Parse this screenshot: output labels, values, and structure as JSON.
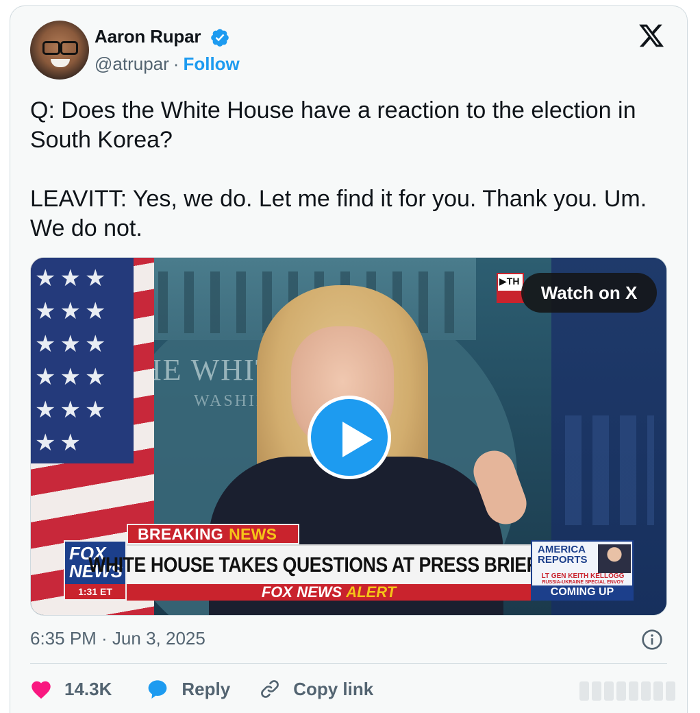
{
  "author": {
    "name": "Aaron Rupar",
    "handle": "@atrupar",
    "separator": "·",
    "follow_label": "Follow"
  },
  "tweet": {
    "paragraphs": [
      "Q: Does the White House have a reaction to the election in South Korea?",
      "LEAVITT: Yes, we do. Let me find it for you. Thank you. Um. We do not."
    ]
  },
  "media": {
    "watch_label": "Watch on X",
    "background_text": {
      "seal_main": "THE WHITE",
      "seal_sub": "WASHIN"
    },
    "chyron": {
      "breaking_label": "BREAKING",
      "breaking_highlight": "NEWS",
      "headline": "WHITE HOUSE TAKES QUESTIONS AT PRESS BRIEFING",
      "alert_label": "FOX NEWS",
      "alert_highlight": "ALERT",
      "logo_line1": "FOX",
      "logo_line2": "NEWS",
      "time": "1:31 ET",
      "promo_title": "AMERICA REPORTS",
      "promo_name": "LT GEN KEITH KELLOGG",
      "promo_role": "RUSSIA-UKRAINE SPECIAL ENVOY",
      "promo_footer": "COMING UP"
    }
  },
  "meta": {
    "timestamp": "6:35 PM · Jun 3, 2025"
  },
  "actions": {
    "likes": "14.3K",
    "reply_label": "Reply",
    "copy_label": "Copy link"
  },
  "colors": {
    "accent": "#1d9bf0",
    "like": "#f91880",
    "text": "#0f1419",
    "muted": "#536471",
    "card_bg": "#f7f9f9"
  }
}
